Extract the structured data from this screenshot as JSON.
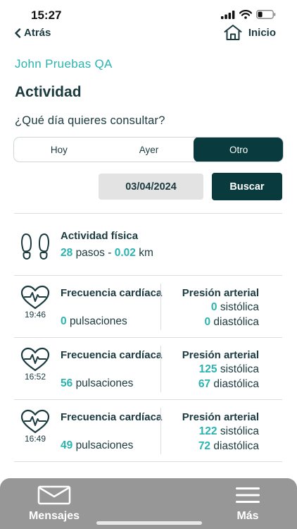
{
  "status_bar": {
    "time": "15:27"
  },
  "nav": {
    "back_label": "Atrás",
    "home_label": "Inicio"
  },
  "user": {
    "name": "John Pruebas QA"
  },
  "page": {
    "title": "Actividad",
    "question": "¿Qué día quieres consultar?"
  },
  "day_selector": {
    "options": [
      "Hoy",
      "Ayer",
      "Otro"
    ],
    "selected": "Otro"
  },
  "date_picker": {
    "value": "03/04/2024"
  },
  "search_button": {
    "label": "Buscar"
  },
  "activity": {
    "title": "Actividad física",
    "steps": "28",
    "steps_unit": "pasos",
    "separator": "-",
    "distance": "0.02",
    "distance_unit": "km"
  },
  "measurements": [
    {
      "time": "19:46",
      "hr_title": "Frecuencia cardíaca",
      "hr_value": "0",
      "hr_unit": "pulsaciones",
      "bp_title": "Presión arterial",
      "systolic": "0",
      "systolic_label": "sistólica",
      "diastolic": "0",
      "diastolic_label": "diastólica"
    },
    {
      "time": "16:52",
      "hr_title": "Frecuencia cardíaca",
      "hr_value": "56",
      "hr_unit": "pulsaciones",
      "bp_title": "Presión arterial",
      "systolic": "125",
      "systolic_label": "sistólica",
      "diastolic": "67",
      "diastolic_label": "diastólica"
    },
    {
      "time": "16:49",
      "hr_title": "Frecuencia cardíaca",
      "hr_value": "49",
      "hr_unit": "pulsaciones",
      "bp_title": "Presión arterial",
      "systolic": "122",
      "systolic_label": "sistólica",
      "diastolic": "72",
      "diastolic_label": "diastólica"
    }
  ],
  "tab_bar": {
    "messages_label": "Mensajes",
    "more_label": "Más"
  },
  "colors": {
    "accent": "#2ab4b0",
    "primary": "#093a3e",
    "text": "#1b3a3f",
    "tab_bar": "#979797"
  },
  "icons": [
    "signal-icon",
    "wifi-icon",
    "battery-icon",
    "chevron-left-icon",
    "home-icon",
    "footprints-icon",
    "heart-pulse-icon",
    "envelope-icon",
    "hamburger-icon"
  ]
}
